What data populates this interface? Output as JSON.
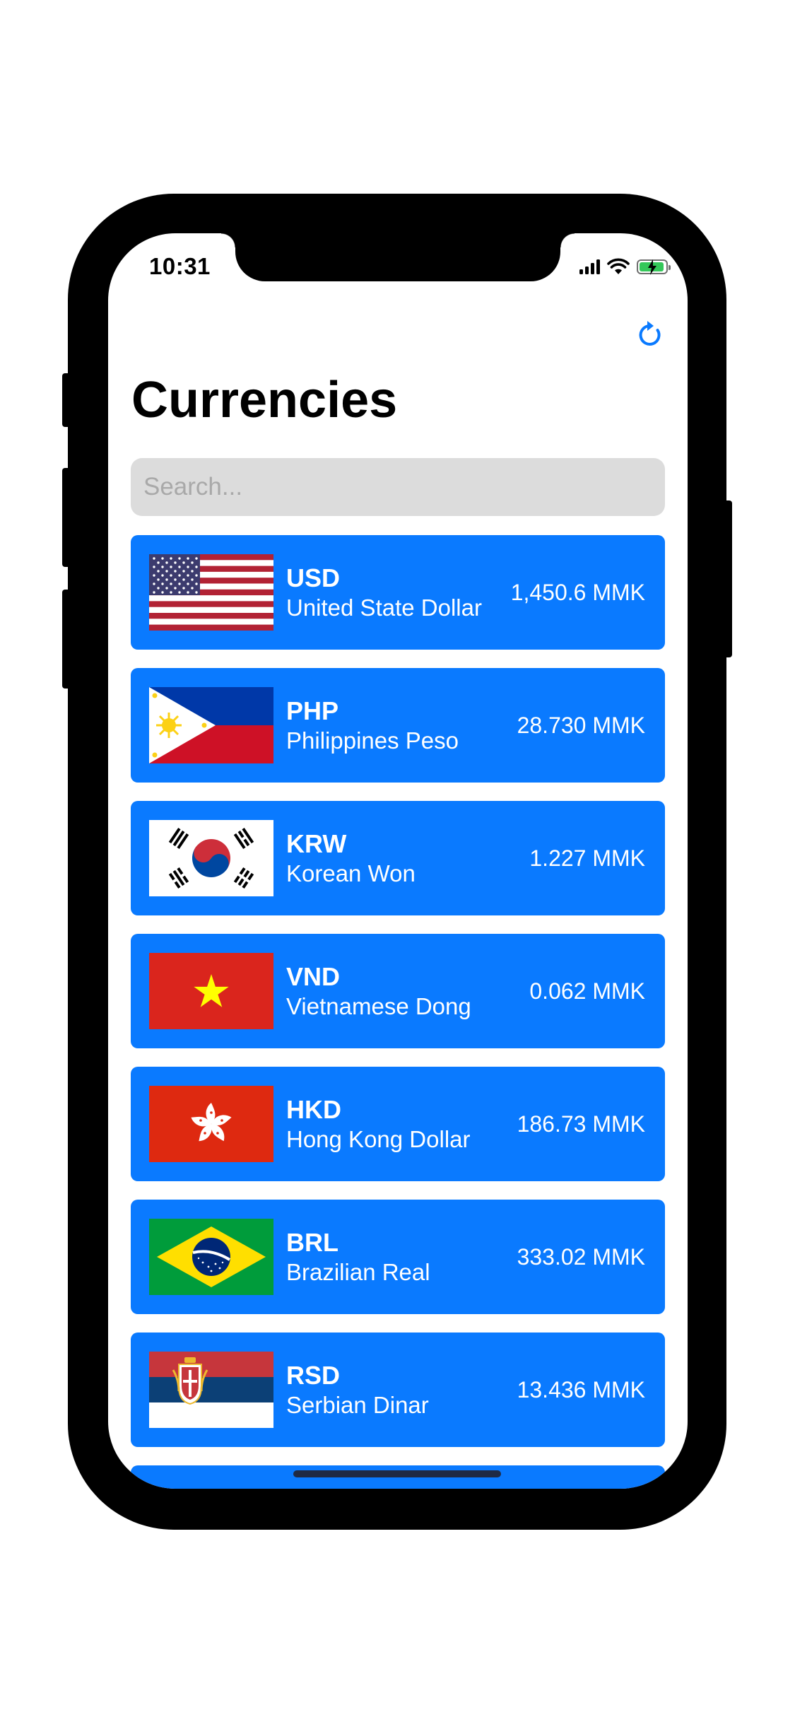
{
  "status_bar": {
    "time": "10:31"
  },
  "header": {
    "title": "Currencies"
  },
  "search": {
    "placeholder": "Search...",
    "value": ""
  },
  "currencies": [
    {
      "code": "USD",
      "name": "United State Dollar",
      "rate": "1,450.6 MMK",
      "flag": "usa-flag-icon"
    },
    {
      "code": "PHP",
      "name": "Philippines Peso",
      "rate": "28.730 MMK",
      "flag": "philippines-flag-icon"
    },
    {
      "code": "KRW",
      "name": "Korean Won",
      "rate": "1.227 MMK",
      "flag": "south-korea-flag-icon"
    },
    {
      "code": "VND",
      "name": "Vietnamese Dong",
      "rate": "0.062 MMK",
      "flag": "vietnam-flag-icon"
    },
    {
      "code": "HKD",
      "name": "Hong Kong Dollar",
      "rate": "186.73 MMK",
      "flag": "hong-kong-flag-icon"
    },
    {
      "code": "BRL",
      "name": "Brazilian Real",
      "rate": "333.02 MMK",
      "flag": "brazil-flag-icon"
    },
    {
      "code": "RSD",
      "name": "Serbian Dinar",
      "rate": "13.436 MMK",
      "flag": "serbia-flag-icon"
    }
  ],
  "colors": {
    "accent": "#0a7aff",
    "card": "#0a7aff",
    "search_bg": "#dcdcdc",
    "battery": "#34c759"
  }
}
